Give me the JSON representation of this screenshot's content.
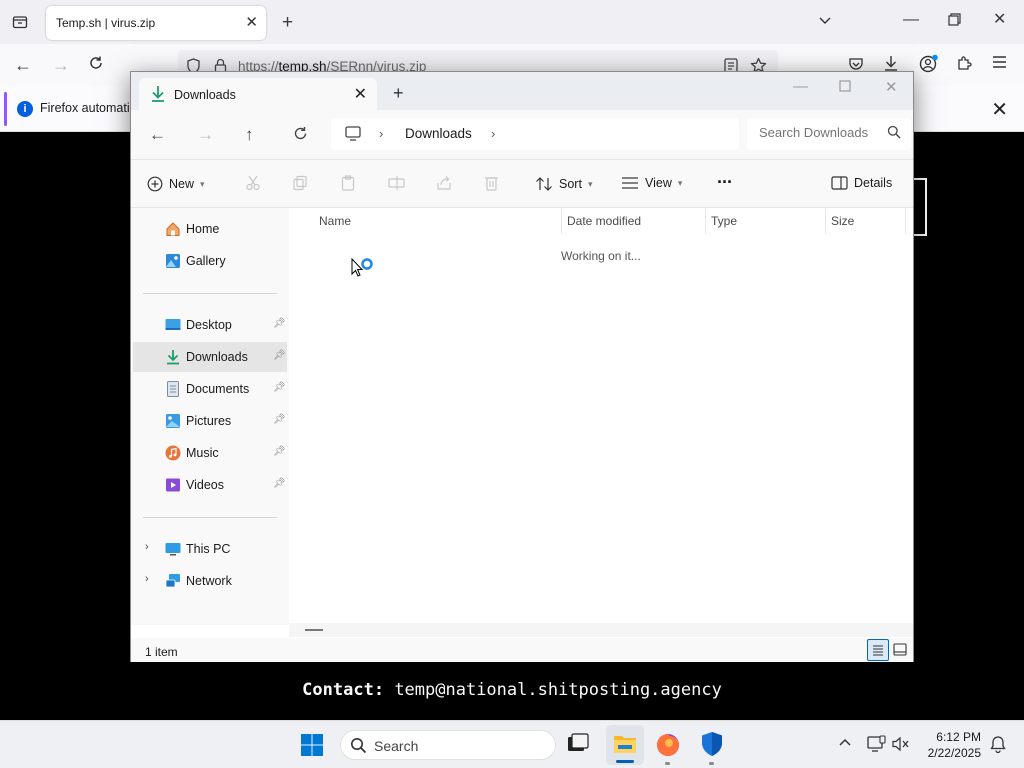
{
  "browser": {
    "tab_title": "Temp.sh | virus.zip",
    "url_prefix": "https://",
    "url_host": "temp.sh",
    "url_path": "/SERnn/virus.zip",
    "notification": "Firefox automatio"
  },
  "page": {
    "contact_label": "Contact:",
    "contact_email": "temp@national.shitposting.agency"
  },
  "explorer": {
    "tab_title": "Downloads",
    "breadcrumb": [
      "Downloads"
    ],
    "search_placeholder": "Search Downloads",
    "toolbar": {
      "new_label": "New",
      "sort_label": "Sort",
      "view_label": "View",
      "more_label": "···",
      "details_label": "Details"
    },
    "nav": {
      "home": "Home",
      "gallery": "Gallery",
      "quick_access": [
        {
          "label": "Desktop"
        },
        {
          "label": "Downloads"
        },
        {
          "label": "Documents"
        },
        {
          "label": "Pictures"
        },
        {
          "label": "Music"
        },
        {
          "label": "Videos"
        }
      ],
      "this_pc": "This PC",
      "network": "Network"
    },
    "columns": [
      "Name",
      "Date modified",
      "Type",
      "Size"
    ],
    "working_text": "Working on it...",
    "status_count": "1 item"
  },
  "taskbar": {
    "search_label": "Search",
    "time": "6:12 PM",
    "date": "2/22/2025"
  },
  "colors": {
    "accent": "#005fb8",
    "download_green": "#1e9e6b",
    "firefox_purple": "#9059ff"
  }
}
